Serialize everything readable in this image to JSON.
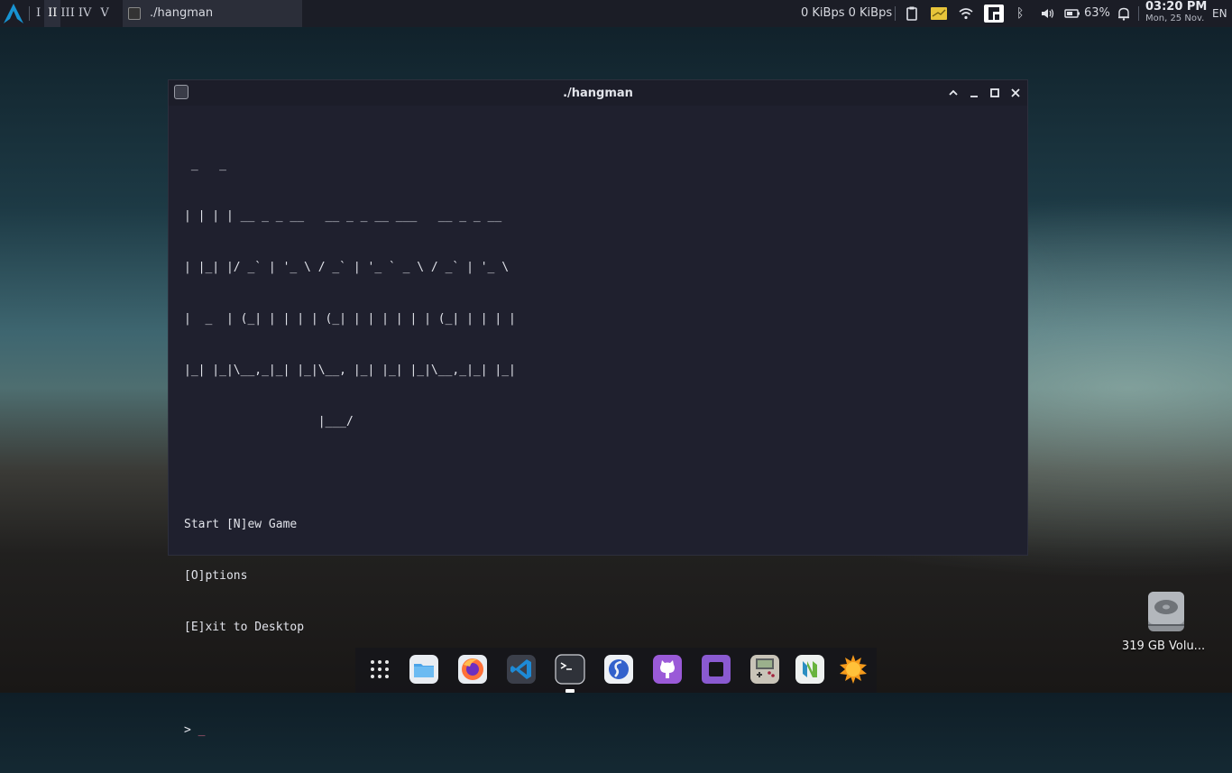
{
  "top_panel": {
    "workspaces": [
      {
        "label": "I",
        "active": false
      },
      {
        "label": "II",
        "active": true
      },
      {
        "label": "III",
        "active": false
      },
      {
        "label": "IV",
        "active": false
      },
      {
        "label": "V",
        "active": false
      }
    ],
    "task_title": "./hangman",
    "net_speed": "0 KiBps 0 KiBps",
    "tray_icons": [
      "clipboard-icon",
      "notes-icon",
      "wifi-icon",
      "app-icon",
      "bluetooth-icon",
      "volume-icon",
      "battery-icon",
      "bell-icon"
    ],
    "battery_percent": "63%",
    "clock_time": "03:20 PM",
    "clock_date": "Mon, 25 Nov.",
    "language": "EN"
  },
  "terminal": {
    "title": "./hangman",
    "ascii_art": [
      " _   _",
      "| | | | __ _ _ __   __ _ _ __ ___   __ _ _ __",
      "| |_| |/ _` | '_ \\ / _` | '_ ` _ \\ / _` | '_ \\",
      "|  _  | (_| | | | | (_| | | | | | | (_| | | | |",
      "|_| |_|\\__,_|_| |_|\\__, |_| |_| |_|\\__,_|_| |_|",
      "                   |___/"
    ],
    "menu": [
      "Start [N]ew Game",
      "[O]ptions",
      "[E]xit to Desktop"
    ],
    "prompt": "> ",
    "cursor": "_"
  },
  "dock": {
    "apps": [
      "app-grid-icon",
      "files-icon",
      "firefox-icon",
      "vscode-icon",
      "terminal-icon",
      "simplenote-icon",
      "github-icon",
      "notes-app-icon",
      "gameboy-icon",
      "neovim-icon",
      "sun-icon"
    ]
  },
  "desktop": {
    "drive_label": "319 GB Volu..."
  },
  "colors": {
    "panel_bg": "#1b1d26",
    "terminal_bg": "#1f202e",
    "cursor": "#e26a8a",
    "accent_blue": "#1793d1"
  }
}
